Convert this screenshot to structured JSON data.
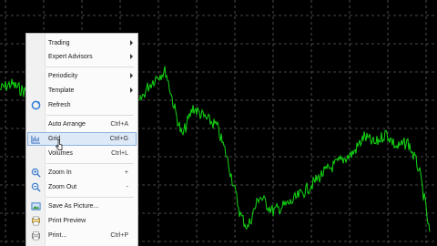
{
  "context_menu": {
    "items": [
      {
        "label": "Trading",
        "submenu": true
      },
      {
        "label": "Expert Advisors",
        "submenu": true
      },
      {
        "label": "Periodicity",
        "submenu": true
      },
      {
        "label": "Template",
        "submenu": true
      },
      {
        "label": "Refresh",
        "icon": "refresh-icon"
      },
      {
        "label": "Auto Arrange",
        "shortcut": "Ctrl+A"
      },
      {
        "label": "Grid",
        "shortcut": "Ctrl+G",
        "icon": "grid-icon",
        "highlighted": true
      },
      {
        "label": "Volumes",
        "shortcut": "Ctrl+L"
      },
      {
        "label": "Zoom In",
        "shortcut": "+",
        "icon": "zoom-in-icon"
      },
      {
        "label": "Zoom Out",
        "shortcut": "-",
        "icon": "zoom-out-icon"
      },
      {
        "label": "Save As Picture...",
        "icon": "save-picture-icon"
      },
      {
        "label": "Print Preview",
        "icon": "print-preview-icon"
      },
      {
        "label": "Print...",
        "shortcut": "Ctrl+P",
        "icon": "print-icon"
      }
    ]
  },
  "colors": {
    "background": "#000000",
    "grid": "#5f5f5f",
    "price_line": "#13d613",
    "menu_highlight": "#dde9f7"
  },
  "chart": {
    "grid_visible": true,
    "grid_style": "dashed"
  }
}
